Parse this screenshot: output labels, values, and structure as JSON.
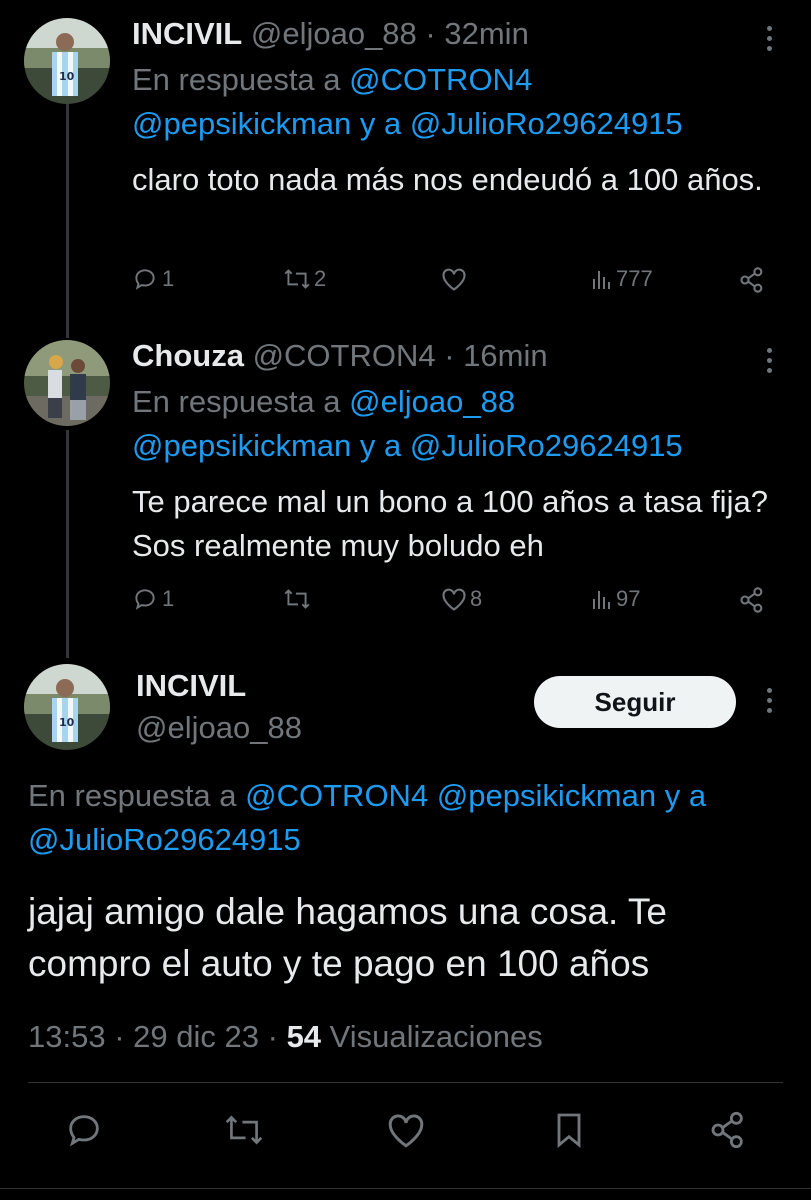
{
  "colors": {
    "background": "#000000",
    "text": "#e7e9ea",
    "muted": "#71767b",
    "link": "#1d9bf0",
    "button_bg": "#eff3f4"
  },
  "reply1": {
    "display_name": "INCIVIL",
    "handle": "@eljoao_88",
    "sep": "·",
    "time": "32min",
    "replying_prefix": "En respuesta a",
    "mention1": "@COTRON4",
    "mention2": "@pepsikickman",
    "conj": "y a",
    "mention3": "@JulioRo29624915",
    "text": "claro toto nada más nos endeudó a 100 años.",
    "replies": "1",
    "retweets": "2",
    "likes": "",
    "views": "777",
    "icons": [
      "reply-icon",
      "retweet-icon",
      "like-icon",
      "views-icon",
      "share-icon"
    ]
  },
  "reply2": {
    "display_name": "Chouza",
    "handle": "@COTRON4",
    "sep": "·",
    "time": "16min",
    "replying_prefix": "En respuesta a",
    "mention1": "@eljoao_88",
    "mention2": "@pepsikickman",
    "conj": "y a",
    "mention3": "@JulioRo29624915",
    "text": "Te parece mal un bono a 100 años a tasa fija? Sos realmente muy boludo eh",
    "replies": "1",
    "retweets": "",
    "likes": "8",
    "views": "97"
  },
  "main_tweet": {
    "display_name": "INCIVIL",
    "handle": "@eljoao_88",
    "follow_label": "Seguir",
    "replying_prefix": "En respuesta a",
    "mention1": "@COTRON4",
    "mention2": "@pepsikickman",
    "conj": "y a",
    "mention3": "@JulioRo29624915",
    "text": "jajaj amigo dale hagamos una cosa. Te compro el auto y te pago en 100 años",
    "time": "13:53",
    "sep": "·",
    "date": "29 dic 23",
    "views_count": "54",
    "views_label": "Visualizaciones"
  }
}
